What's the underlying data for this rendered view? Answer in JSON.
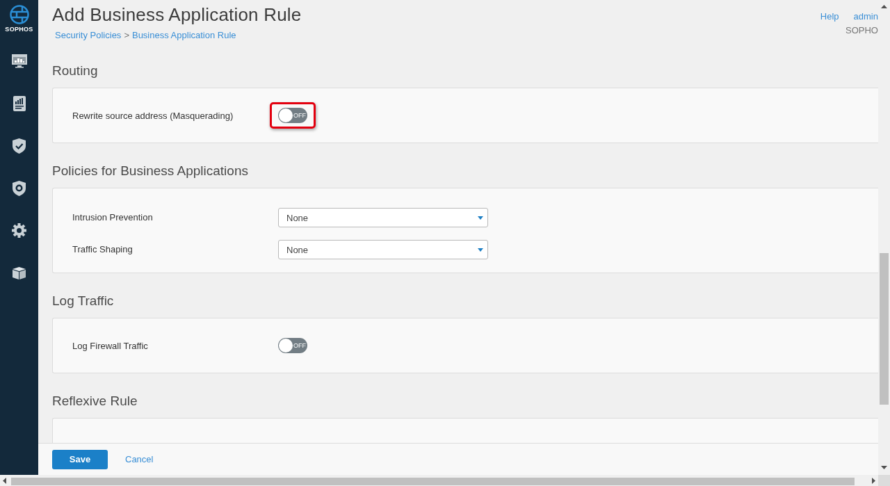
{
  "brand": {
    "name": "SOPHOS"
  },
  "header": {
    "title": "Add Business Application Rule",
    "breadcrumb": [
      "Security Policies",
      "Business Application Rule"
    ],
    "separator": ">",
    "links": [
      "Help",
      "admin"
    ],
    "user_org": "SOPHO"
  },
  "sections": [
    {
      "title": "Routing",
      "rows": [
        {
          "kind": "toggle",
          "label": "Rewrite source address (Masquerading)",
          "on": false,
          "state_text": "OFF",
          "highlighted": true
        }
      ]
    },
    {
      "title": "Policies for Business Applications",
      "rows": [
        {
          "kind": "select",
          "label": "Intrusion Prevention",
          "value": "None"
        },
        {
          "kind": "select",
          "label": "Traffic Shaping",
          "value": "None"
        }
      ]
    },
    {
      "title": "Log Traffic",
      "rows": [
        {
          "kind": "toggle",
          "label": "Log Firewall Traffic",
          "on": false,
          "state_text": "OFF",
          "highlighted": false
        }
      ]
    },
    {
      "title": "Reflexive Rule"
    }
  ],
  "footer": {
    "buttons": [
      {
        "kind": "primary",
        "label": "Save"
      },
      {
        "kind": "link",
        "label": "Cancel"
      }
    ]
  }
}
